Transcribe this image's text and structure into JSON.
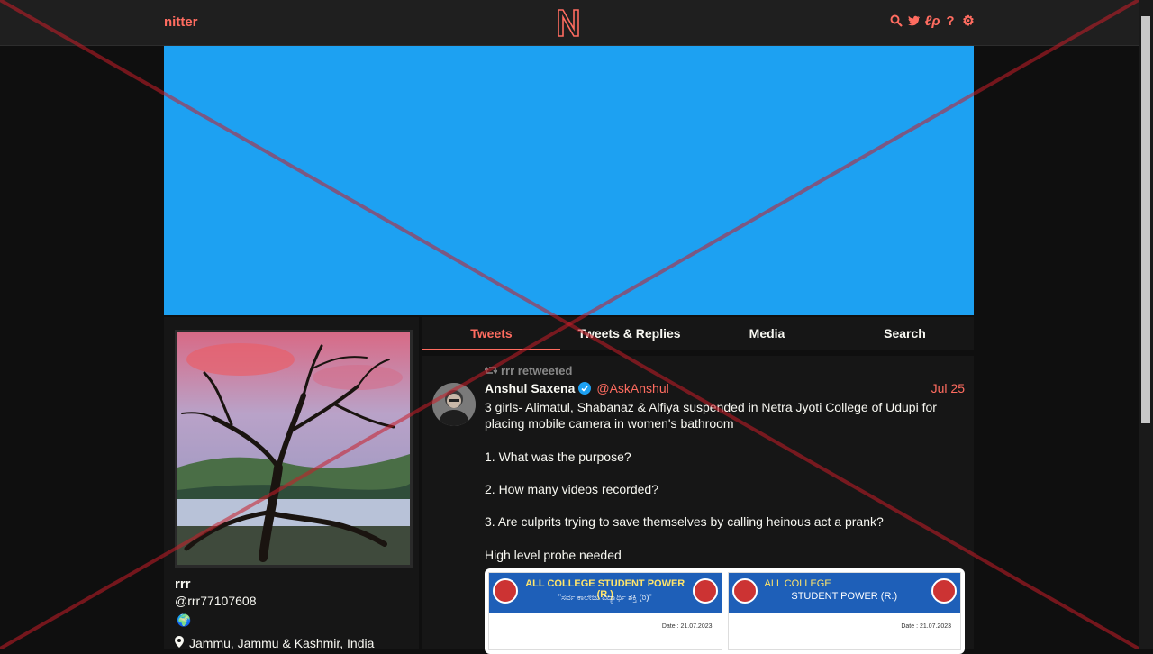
{
  "nav": {
    "brand": "nitter",
    "icons": [
      "search-icon",
      "twitter-bird-icon",
      "rss-icon",
      "help-icon",
      "gear-icon"
    ],
    "accent_color": "#ff6c60"
  },
  "banner": {
    "color": "#1da1f2"
  },
  "profile": {
    "name": "rrr",
    "handle": "@rrr77107608",
    "globe": "🌍",
    "location": "Jammu, Jammu & Kashmir, India"
  },
  "tabs": [
    {
      "label": "Tweets",
      "active": true
    },
    {
      "label": "Tweets & Replies",
      "active": false
    },
    {
      "label": "Media",
      "active": false
    },
    {
      "label": "Search",
      "active": false
    }
  ],
  "tweet": {
    "retweet_label": "rrr retweeted",
    "author_name": "Anshul Saxena",
    "author_handle": "@AskAnshul",
    "verified": true,
    "date": "Jul 25",
    "lines": [
      "3 girls- Alimatul, Shabanaz & Alfiya suspended in Netra Jyoti College of Udupi for placing mobile camera in women's bathroom",
      "1. What was the purpose?",
      "2. How many videos recorded?",
      "3. Are culprits trying to save themselves by calling heinous act a prank?",
      "High level probe needed"
    ],
    "media": [
      {
        "header": "ALL COLLEGE STUDENT POWER (R.)",
        "subheader": "\"ಸರ್ವ ಕಾಲೇಜು ವಿದ್ಯಾರ್ಥಿ ಶಕ್ತಿ (ರಿ)\"",
        "date": "Date : 21.07.2023"
      },
      {
        "header": "ALL COLLEGE",
        "subheader": "STUDENT POWER (R.)",
        "date": "Date : 21.07.2023"
      }
    ]
  }
}
